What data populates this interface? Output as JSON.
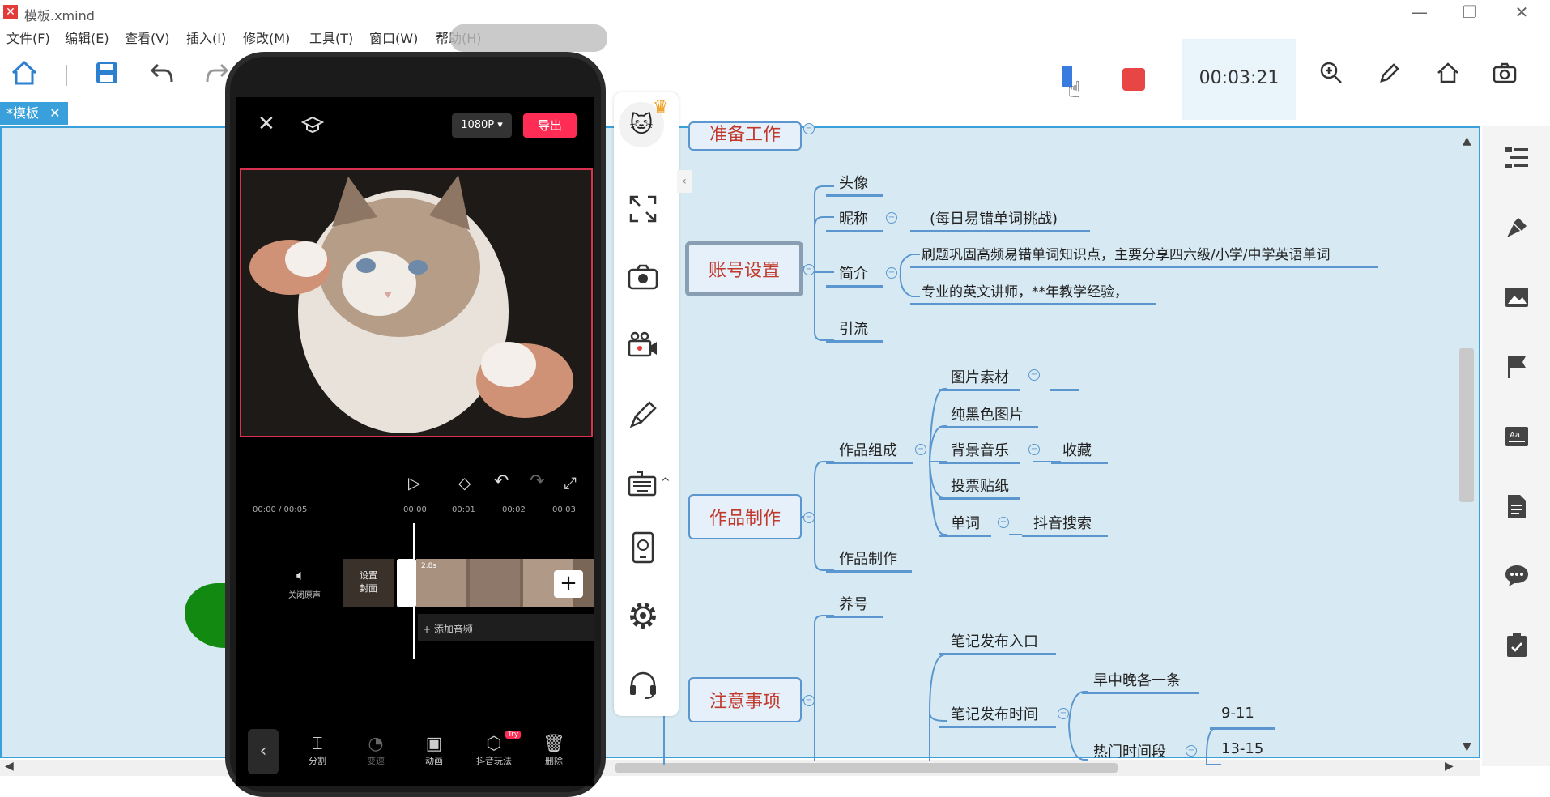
{
  "window": {
    "title": "模板.xmind",
    "minimize": "—",
    "restore": "❐",
    "close": "✕"
  },
  "menu": [
    "文件(F)",
    "编辑(E)",
    "查看(V)",
    "插入(I)",
    "修改(M)",
    "工具(T)",
    "窗口(W)",
    "帮助(H)"
  ],
  "tab": {
    "label": "*模板",
    "close": "✕"
  },
  "recorder": {
    "time": "00:03:21"
  },
  "mindmap": {
    "topics": {
      "t0": "准备工作",
      "t1": "账号设置",
      "t2": "作品制作",
      "t3": "注意事项"
    },
    "account": {
      "avatar": "头像",
      "nickname": "昵称",
      "nickname_value": "(每日易错单词挑战)",
      "intro": "简介",
      "intro_1": "刷题巩固高频易错单词知识点，主要分享四六级/小学/中学英语单词",
      "intro_2": "专业的英文讲师，**年教学经验，",
      "traffic": "引流"
    },
    "works": {
      "composition": "作品组成",
      "image_material": "图片素材",
      "black_image": "纯黑色图片",
      "bgm": "背景音乐",
      "collect": "收藏",
      "vote_sticker": "投票贴纸",
      "word": "单词",
      "douyin_search": "抖音搜索",
      "making": "作品制作"
    },
    "notes": {
      "raise": "养号",
      "entry": "笔记发布入口",
      "time": "笔记发布时间",
      "daily": "早中晚各一条",
      "hot": "热门时间段",
      "h1": "9-11",
      "h2": "13-15"
    }
  },
  "phone": {
    "resolution": "1080P ▾",
    "export": "导出",
    "timecode_current": "00:00 / 00:05",
    "ticks": [
      "00:00",
      "00:01",
      "00:02",
      "00:03"
    ],
    "mute_label": "关闭原声",
    "cover_label": "设置\n封面",
    "clip_duration": "2.8s",
    "add_audio": "+ 添加音频",
    "tools": [
      "分割",
      "变速",
      "动画",
      "抖音玩法",
      "删除"
    ],
    "try_badge": "Try"
  },
  "colors": {
    "accent": "#3aa0dc",
    "canvas": "#d7e9f2",
    "topic_text": "#c0392b",
    "record": "#e84545",
    "export": "#ff2d55"
  }
}
